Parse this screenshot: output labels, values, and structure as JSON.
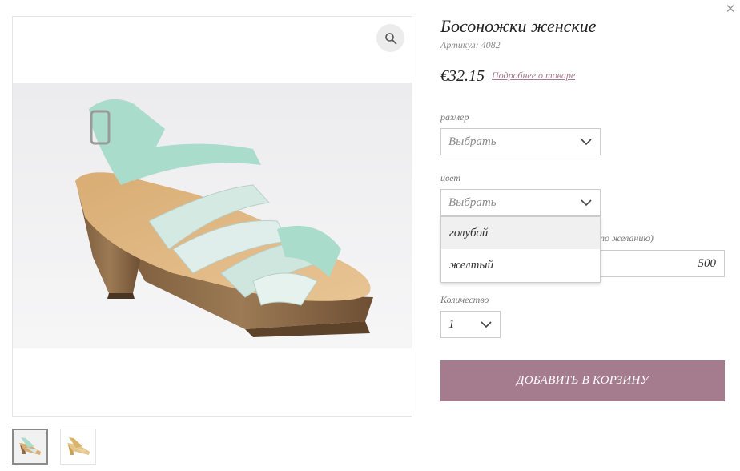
{
  "product": {
    "title": "Босоножки женские",
    "sku": "Артикул: 4082",
    "price": "€32.15",
    "details_link": "Подробнее о товаре"
  },
  "gallery": {
    "main_image": "mint-green-heeled-sandal",
    "thumbnails": [
      {
        "image": "mint-green-heeled-sandal",
        "active": true
      },
      {
        "image": "gold-heeled-sandal",
        "active": false
      }
    ],
    "zoom_icon": "search-icon"
  },
  "options": {
    "size": {
      "label": "размер",
      "value": "Выбрать"
    },
    "color": {
      "label": "цвет",
      "value": "Выбрать",
      "open": true,
      "options": [
        "голубой",
        "желтый"
      ]
    },
    "amount": {
      "label_partial": "желанию)",
      "value": "500"
    },
    "quantity": {
      "label": "Количество",
      "value": "1"
    }
  },
  "actions": {
    "add_to_cart": "ДОБАВИТЬ В КОРЗИНУ",
    "close_icon": "close-icon"
  },
  "colors": {
    "accent": "#a57c8e",
    "link": "#a67b8d"
  }
}
